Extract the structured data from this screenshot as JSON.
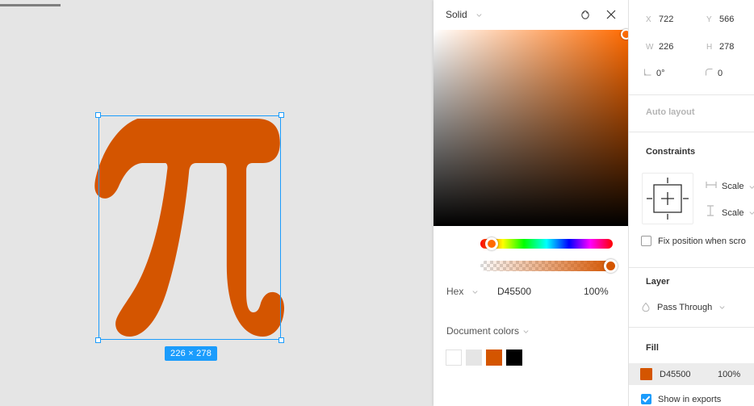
{
  "canvas": {
    "selection": {
      "size_badge": "226 × 278",
      "glyph": "pi-symbol",
      "glyph_color": "#d45500",
      "selection_color": "#1b9cfc",
      "background": "#e5e5e5"
    }
  },
  "picker": {
    "title": "Solid",
    "title_caret": "chevron-down-icon",
    "reset_icon": "reset-icon",
    "close_icon": "close-icon",
    "eyedropper_icon": "eyedropper-icon",
    "hex_label": "Hex",
    "hex_caret": "chevron-down-icon",
    "hex_value": "D45500",
    "alpha_value": "100%",
    "document_colors_label": "Document colors",
    "document_colors_caret": "chevron-down-icon",
    "swatches": [
      "#ffffff",
      "#e5e5e5",
      "#d45500",
      "#000000"
    ]
  },
  "right_panel": {
    "properties": [
      {
        "icon": "x-position-icon",
        "label": "X",
        "value": "722"
      },
      {
        "icon": "y-position-icon",
        "label": "Y",
        "value": "566"
      },
      {
        "icon": "width-icon",
        "label": "W",
        "value": "226"
      },
      {
        "icon": "height-icon",
        "label": "H",
        "value": "278"
      },
      {
        "icon": "rotation-icon",
        "label": "",
        "value": "0°"
      },
      {
        "icon": "corner-radius-icon",
        "label": "",
        "value": "0"
      }
    ],
    "auto_layout_title": "Auto layout",
    "constraints_title": "Constraints",
    "constraint_horizontal": {
      "icon": "horizontal-constraint-icon",
      "value": "Scale",
      "caret": "chevron-down-icon"
    },
    "constraint_vertical": {
      "icon": "vertical-constraint-icon",
      "value": "Scale",
      "caret": "chevron-down-icon"
    },
    "fix_position_label": "Fix position when scro",
    "fix_position_checked": false,
    "layer_title": "Layer",
    "blend_mode_icon": "blend-mode-icon",
    "blend_mode": "Pass Through",
    "blend_mode_caret": "chevron-down-icon",
    "fill_title": "Fill",
    "fill_swatch_color": "#d45500",
    "fill_hex": "D45500",
    "fill_opacity": "100%",
    "show_in_exports_label": "Show in exports",
    "show_in_exports_checked": true
  }
}
